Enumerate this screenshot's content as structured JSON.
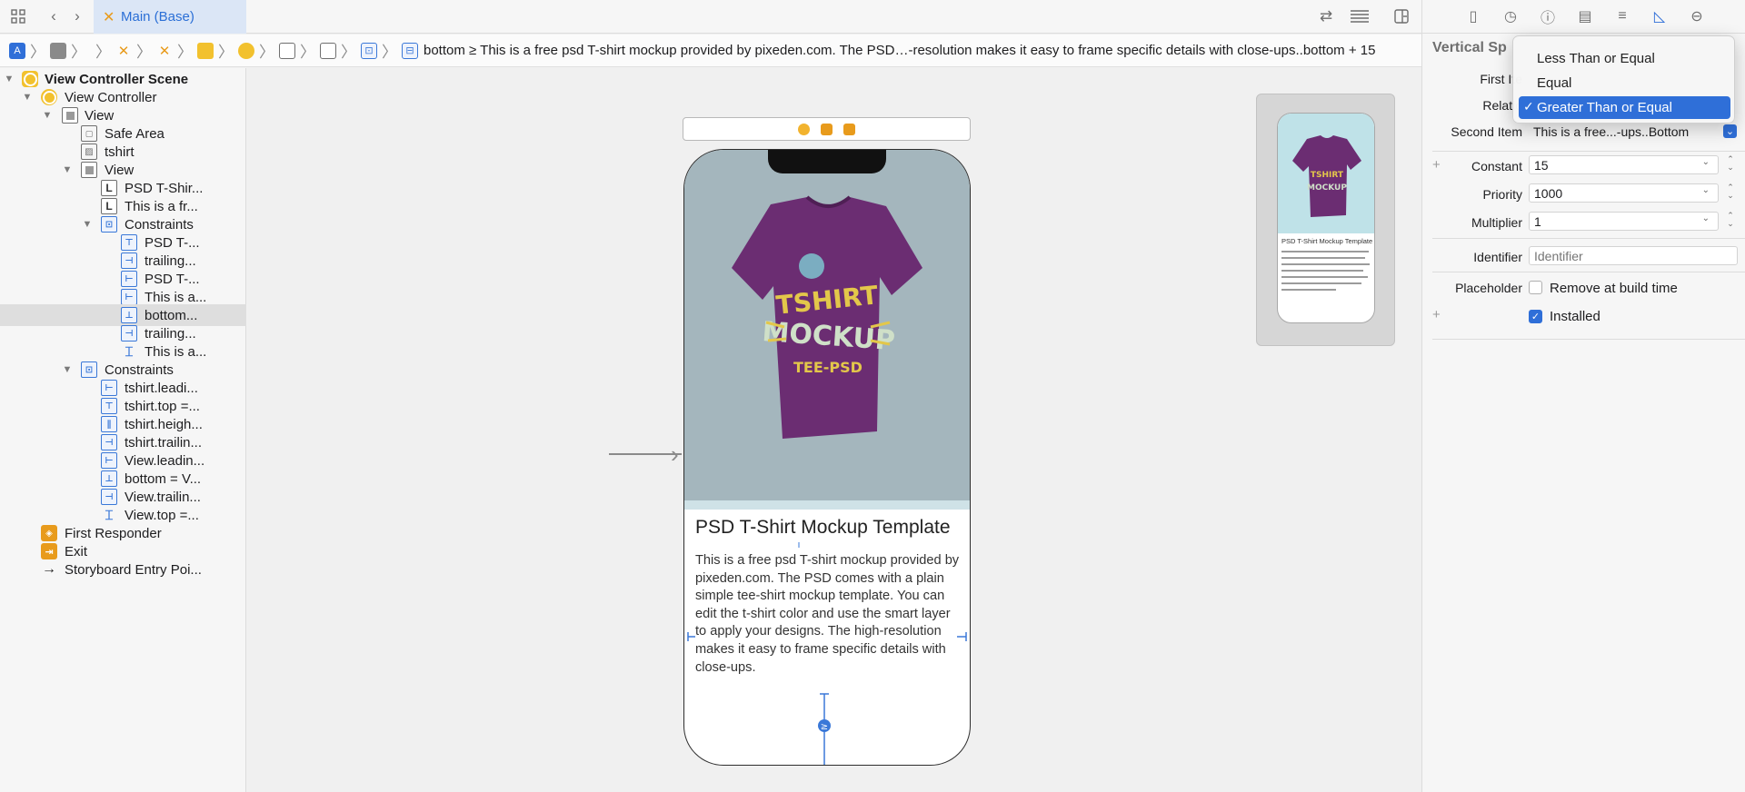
{
  "toolbar": {
    "editor_tab": "Main (Base)"
  },
  "jumpbar": {
    "path_text": "bottom ≥ This is a free psd T-shirt mockup provided by pixeden.com. The PSD…-resolution makes it easy to frame specific details with close-ups..bottom + 15"
  },
  "navigator": {
    "items": [
      {
        "label": "View Controller Scene"
      },
      {
        "label": "View Controller"
      },
      {
        "label": "View"
      },
      {
        "label": "Safe Area"
      },
      {
        "label": "tshirt"
      },
      {
        "label": "View"
      },
      {
        "label": "PSD T-Shir..."
      },
      {
        "label": "This is a fr..."
      },
      {
        "label": "Constraints"
      },
      {
        "label": "PSD T-..."
      },
      {
        "label": "trailing..."
      },
      {
        "label": "PSD T-..."
      },
      {
        "label": "This is a..."
      },
      {
        "label": "bottom..."
      },
      {
        "label": "trailing..."
      },
      {
        "label": "This is a..."
      },
      {
        "label": "Constraints"
      },
      {
        "label": "tshirt.leadi..."
      },
      {
        "label": "tshirt.top =..."
      },
      {
        "label": "tshirt.heigh..."
      },
      {
        "label": "tshirt.trailin..."
      },
      {
        "label": "View.leadin..."
      },
      {
        "label": "bottom = V..."
      },
      {
        "label": "View.trailin..."
      },
      {
        "label": "View.top =..."
      },
      {
        "label": "First Responder"
      },
      {
        "label": "Exit"
      },
      {
        "label": "Storyboard Entry Poi..."
      }
    ]
  },
  "canvas": {
    "phone_title": "PSD T-Shirt Mockup Template",
    "phone_body": "This is a free psd T-shirt mockup provided by pixeden.com. The PSD comes with a plain simple tee-shirt mockup template. You can edit the t-shirt color and use the smart layer to apply your designs. The high-resolution makes it easy to frame specific details with close-ups.",
    "mini_title": "PSD T-Shirt Mockup Template",
    "shirt_color": "#6b2d72",
    "shirt_bg": "#a4b6bd"
  },
  "inspector": {
    "section_title": "Vertical Sp",
    "first_item_label": "First Ite",
    "relation_label": "Relatio",
    "second_item_label": "Second Item",
    "second_item_value": "This is a free...-ups..Bottom",
    "constant_label": "Constant",
    "constant_value": "15",
    "priority_label": "Priority",
    "priority_value": "1000",
    "multiplier_label": "Multiplier",
    "multiplier_value": "1",
    "identifier_label": "Identifier",
    "identifier_placeholder": "Identifier",
    "placeholder_label": "Placeholder",
    "remove_at_build": "Remove at build time",
    "installed": "Installed"
  },
  "relation_menu": {
    "options": [
      "Less Than or Equal",
      "Equal",
      "Greater Than or Equal"
    ],
    "selected": "Greater Than or Equal"
  },
  "colors": {
    "accent": "#2f6fd8",
    "selection_row": "#dedede"
  }
}
